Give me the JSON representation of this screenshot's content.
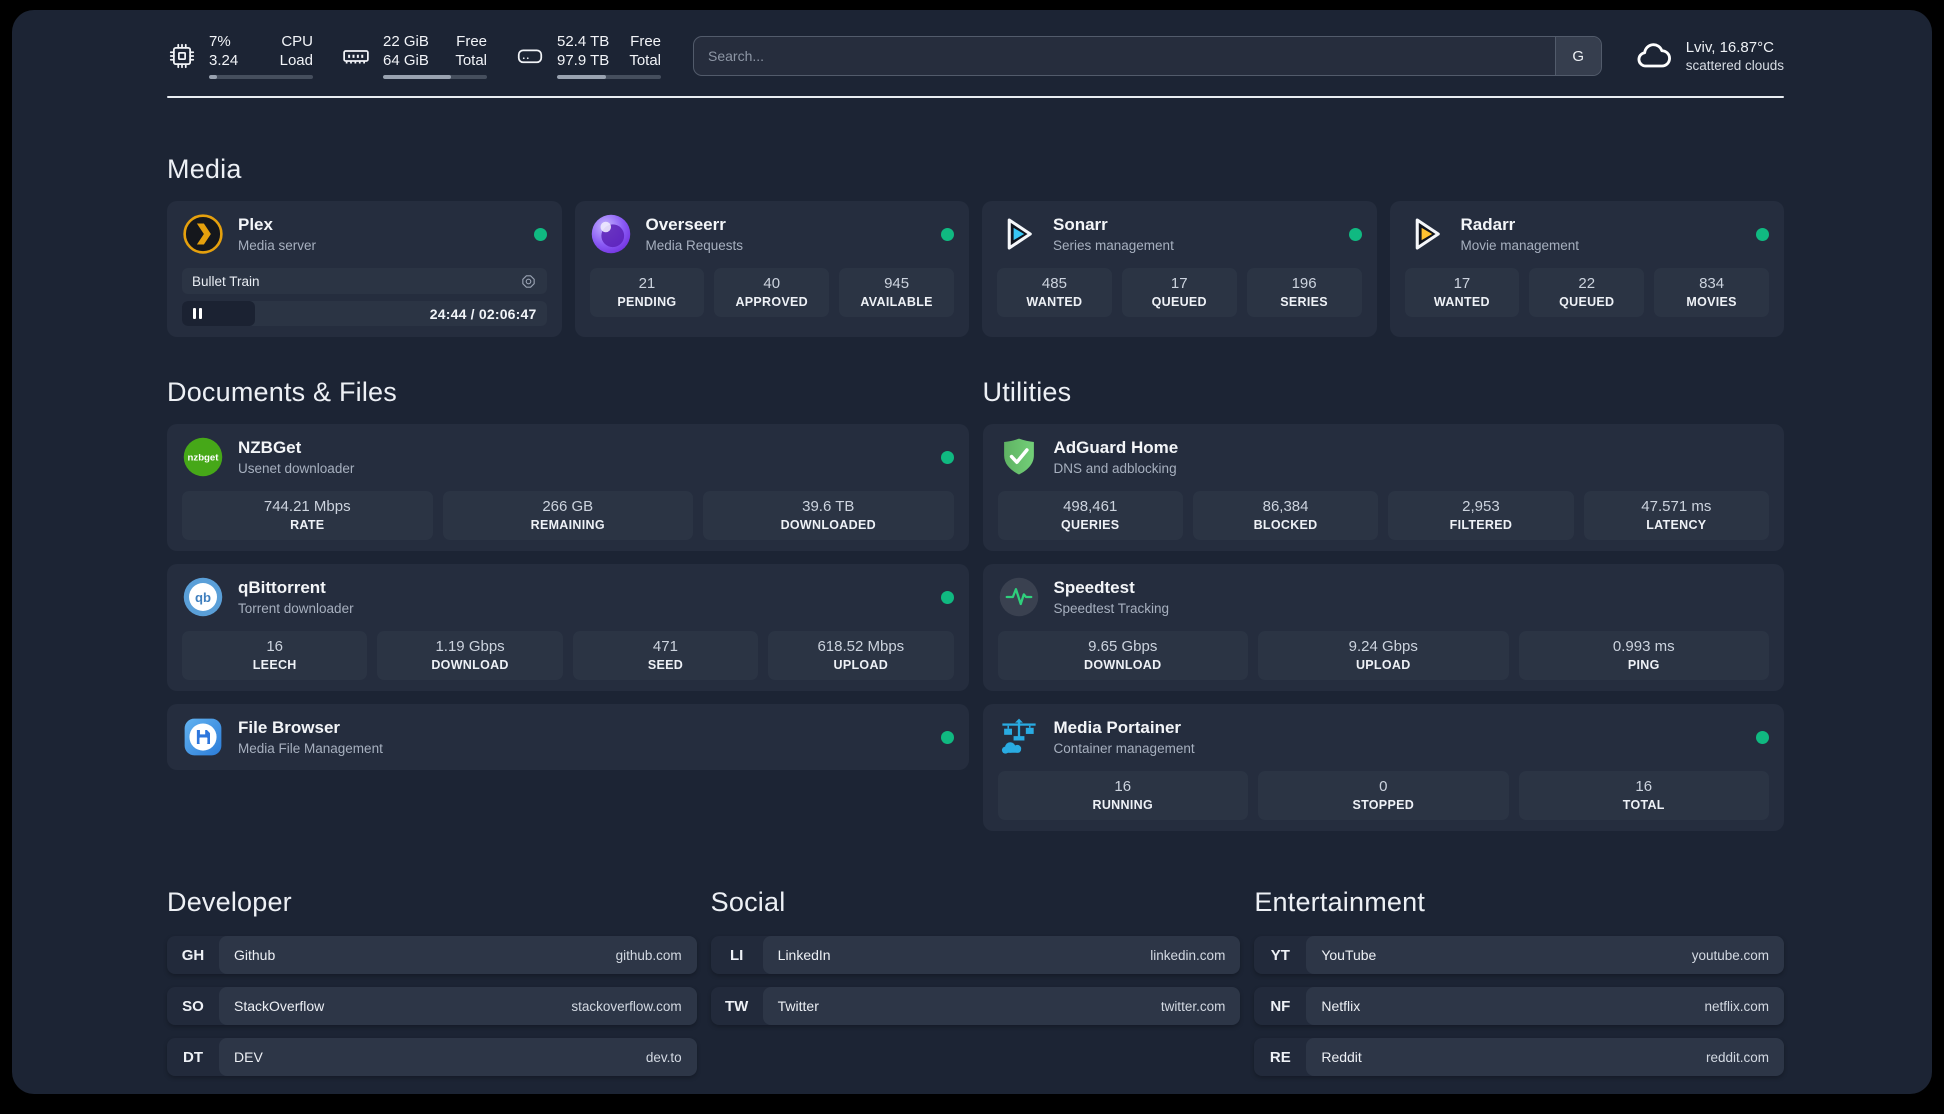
{
  "colors": {
    "status_online": "#10b981",
    "plex_gold": "#e5a00d",
    "sonarr_cyan": "#38c6f4",
    "radarr_amber": "#ffc230",
    "nzbget_green": "#46a818",
    "qbittorrent_blue": "#5a9fd8",
    "adguard_green": "#68c16f",
    "speedtest_green": "#2fd07c",
    "filebrowser_blue": "#2b7cd9",
    "portainer_blue": "#29abe2"
  },
  "system_stats": [
    {
      "id": "cpu",
      "icon": "cpu-icon",
      "value_top": "7%",
      "value_bottom": "3.24",
      "label_top": "CPU",
      "label_bottom": "Load",
      "progress_pct": 8
    },
    {
      "id": "memory",
      "icon": "ram-icon",
      "value_top": "22 GiB",
      "value_bottom": "64 GiB",
      "label_top": "Free",
      "label_bottom": "Total",
      "progress_pct": 65
    },
    {
      "id": "storage",
      "icon": "disk-icon",
      "value_top": "52.4 TB",
      "value_bottom": "97.9 TB",
      "label_top": "Free",
      "label_bottom": "Total",
      "progress_pct": 47
    }
  ],
  "search": {
    "placeholder": "Search...",
    "button_label": "G"
  },
  "weather": {
    "icon": "cloud-icon",
    "location_temp": "Lviv, 16.87°C",
    "condition": "scattered clouds"
  },
  "sections": {
    "media": {
      "title": "Media",
      "plex": {
        "icon": "plex-icon",
        "title": "Plex",
        "subtitle": "Media server",
        "status": "online",
        "now_playing": {
          "title": "Bullet Train",
          "time_display": "24:44 / 02:06:47",
          "progress_pct": 20,
          "state": "paused"
        }
      },
      "apps": [
        {
          "icon": "overseerr-icon",
          "title": "Overseerr",
          "subtitle": "Media Requests",
          "status": "online",
          "stats": [
            {
              "value": "21",
              "label": "PENDING"
            },
            {
              "value": "40",
              "label": "APPROVED"
            },
            {
              "value": "945",
              "label": "AVAILABLE"
            }
          ]
        },
        {
          "icon": "sonarr-icon",
          "title": "Sonarr",
          "subtitle": "Series management",
          "status": "online",
          "stats": [
            {
              "value": "485",
              "label": "WANTED"
            },
            {
              "value": "17",
              "label": "QUEUED"
            },
            {
              "value": "196",
              "label": "SERIES"
            }
          ]
        },
        {
          "icon": "radarr-icon",
          "title": "Radarr",
          "subtitle": "Movie management",
          "status": "online",
          "stats": [
            {
              "value": "17",
              "label": "WANTED"
            },
            {
              "value": "22",
              "label": "QUEUED"
            },
            {
              "value": "834",
              "label": "MOVIES"
            }
          ]
        }
      ]
    },
    "documents": {
      "title": "Documents & Files",
      "apps": [
        {
          "icon": "nzbget-icon",
          "title": "NZBGet",
          "subtitle": "Usenet downloader",
          "status": "online",
          "stats": [
            {
              "value": "744.21 Mbps",
              "label": "RATE"
            },
            {
              "value": "266 GB",
              "label": "REMAINING"
            },
            {
              "value": "39.6 TB",
              "label": "DOWNLOADED"
            }
          ]
        },
        {
          "icon": "qbittorrent-icon",
          "title": "qBittorrent",
          "subtitle": "Torrent downloader",
          "status": "online",
          "stats": [
            {
              "value": "16",
              "label": "LEECH"
            },
            {
              "value": "1.19 Gbps",
              "label": "DOWNLOAD"
            },
            {
              "value": "471",
              "label": "SEED"
            },
            {
              "value": "618.52 Mbps",
              "label": "UPLOAD"
            }
          ]
        },
        {
          "icon": "filebrowser-icon",
          "title": "File Browser",
          "subtitle": "Media File Management",
          "status": "online",
          "stats": []
        }
      ]
    },
    "utilities": {
      "title": "Utilities",
      "apps": [
        {
          "icon": "adguard-icon",
          "title": "AdGuard Home",
          "subtitle": "DNS and adblocking",
          "status": null,
          "stats": [
            {
              "value": "498,461",
              "label": "QUERIES"
            },
            {
              "value": "86,384",
              "label": "BLOCKED"
            },
            {
              "value": "2,953",
              "label": "FILTERED"
            },
            {
              "value": "47.571 ms",
              "label": "LATENCY"
            }
          ]
        },
        {
          "icon": "speedtest-icon",
          "title": "Speedtest",
          "subtitle": "Speedtest Tracking",
          "status": null,
          "stats": [
            {
              "value": "9.65 Gbps",
              "label": "DOWNLOAD"
            },
            {
              "value": "9.24 Gbps",
              "label": "UPLOAD"
            },
            {
              "value": "0.993 ms",
              "label": "PING"
            }
          ]
        },
        {
          "icon": "portainer-icon",
          "title": "Media Portainer",
          "subtitle": "Container management",
          "status": "online",
          "stats": [
            {
              "value": "16",
              "label": "RUNNING"
            },
            {
              "value": "0",
              "label": "STOPPED"
            },
            {
              "value": "16",
              "label": "TOTAL"
            }
          ]
        }
      ]
    },
    "bookmarks": [
      {
        "title": "Developer",
        "items": [
          {
            "abbr": "GH",
            "name": "Github",
            "url": "github.com"
          },
          {
            "abbr": "SO",
            "name": "StackOverflow",
            "url": "stackoverflow.com"
          },
          {
            "abbr": "DT",
            "name": "DEV",
            "url": "dev.to"
          }
        ]
      },
      {
        "title": "Social",
        "items": [
          {
            "abbr": "LI",
            "name": "LinkedIn",
            "url": "linkedin.com"
          },
          {
            "abbr": "TW",
            "name": "Twitter",
            "url": "twitter.com"
          }
        ]
      },
      {
        "title": "Entertainment",
        "items": [
          {
            "abbr": "YT",
            "name": "YouTube",
            "url": "youtube.com"
          },
          {
            "abbr": "NF",
            "name": "Netflix",
            "url": "netflix.com"
          },
          {
            "abbr": "RE",
            "name": "Reddit",
            "url": "reddit.com"
          }
        ]
      }
    ]
  }
}
